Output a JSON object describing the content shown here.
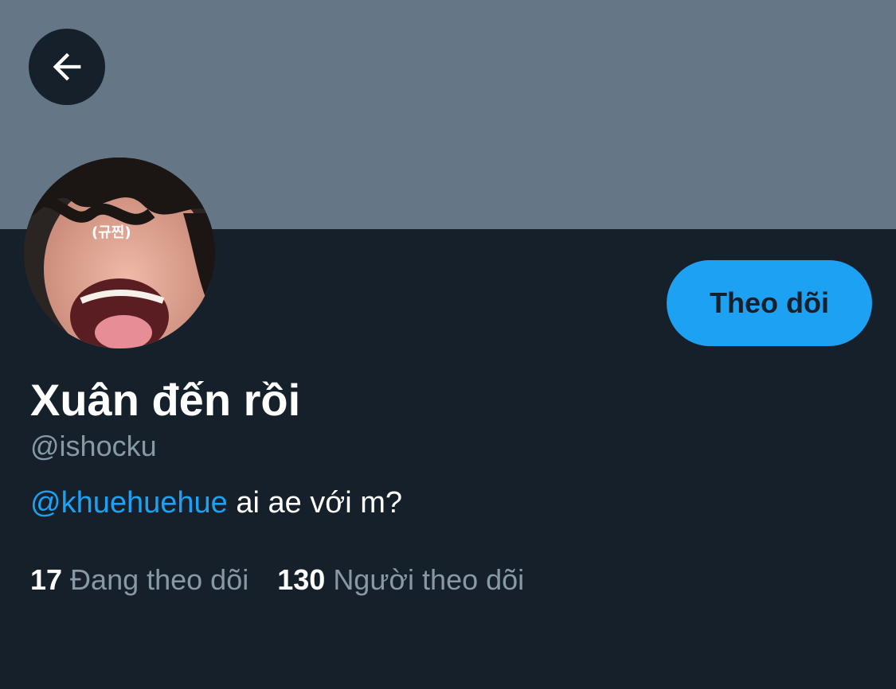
{
  "header": {
    "back_icon": "arrow-left-icon",
    "banner_color": "#657786"
  },
  "profile": {
    "avatar_icon": "profile-photo",
    "avatar_caption": "(규찐)",
    "display_name": "Xuân đến rồi",
    "handle": "@ishocku",
    "bio_mention": "@khuehuehue",
    "bio_text": " ai ae với m?",
    "follow_label": "Theo dõi"
  },
  "stats": {
    "following_count": "17",
    "following_label": "Đang theo dõi",
    "followers_count": "130",
    "followers_label": "Người theo dõi"
  },
  "colors": {
    "background": "#15202b",
    "accent": "#1da1f2",
    "muted_text": "#8899a6"
  }
}
